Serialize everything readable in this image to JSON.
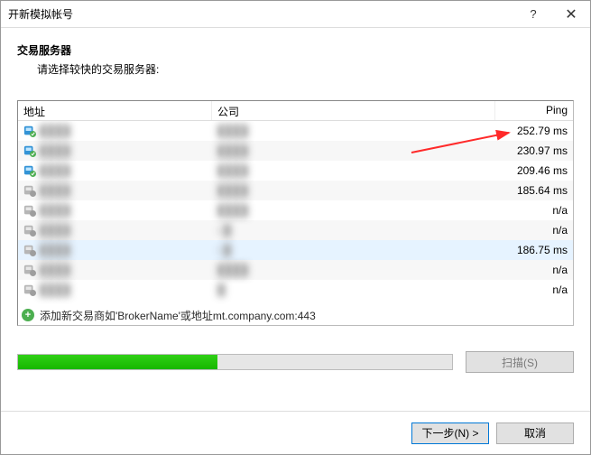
{
  "window": {
    "title": "开新模拟帐号",
    "help_glyph": "?",
    "close_glyph": "✕"
  },
  "header": {
    "title": "交易服务器",
    "subtitle": "请选择较快的交易服务器:"
  },
  "columns": {
    "address": "地址",
    "company": "公司",
    "ping": "Ping"
  },
  "rows": [
    {
      "icon": "green",
      "address": "████",
      "company": "████",
      "ping": "252.79 ms",
      "selected": false
    },
    {
      "icon": "green",
      "address": "████",
      "company": "████",
      "ping": "230.97 ms",
      "selected": false
    },
    {
      "icon": "green",
      "address": "████",
      "company": "████",
      "ping": "209.46 ms",
      "selected": false
    },
    {
      "icon": "gray",
      "address": "████",
      "company": "████",
      "ping": "185.64 ms",
      "selected": false
    },
    {
      "icon": "gray",
      "address": "████",
      "company": "████",
      "ping": "n/a",
      "selected": false
    },
    {
      "icon": "gray",
      "address": "████",
      "company": "L█",
      "ping": "n/a",
      "selected": false
    },
    {
      "icon": "gray",
      "address": "████",
      "company": "L█",
      "ping": "186.75 ms",
      "selected": true
    },
    {
      "icon": "gray",
      "address": "████",
      "company": "████",
      "ping": "n/a",
      "selected": false
    },
    {
      "icon": "gray",
      "address": "████",
      "company": "█",
      "ping": "n/a",
      "selected": false
    }
  ],
  "addline": {
    "text": "添加新交易商如'BrokerName'或地址mt.company.com:443"
  },
  "progress": {
    "percent": 46
  },
  "buttons": {
    "scan": "扫描(S)",
    "next": "下一步(N) >",
    "cancel": "取消"
  },
  "colors": {
    "icon_green": "#29a6d9",
    "icon_green_corner": "#4caf50",
    "icon_gray": "#b6b6b6",
    "arrow": "#ff2a2a"
  }
}
